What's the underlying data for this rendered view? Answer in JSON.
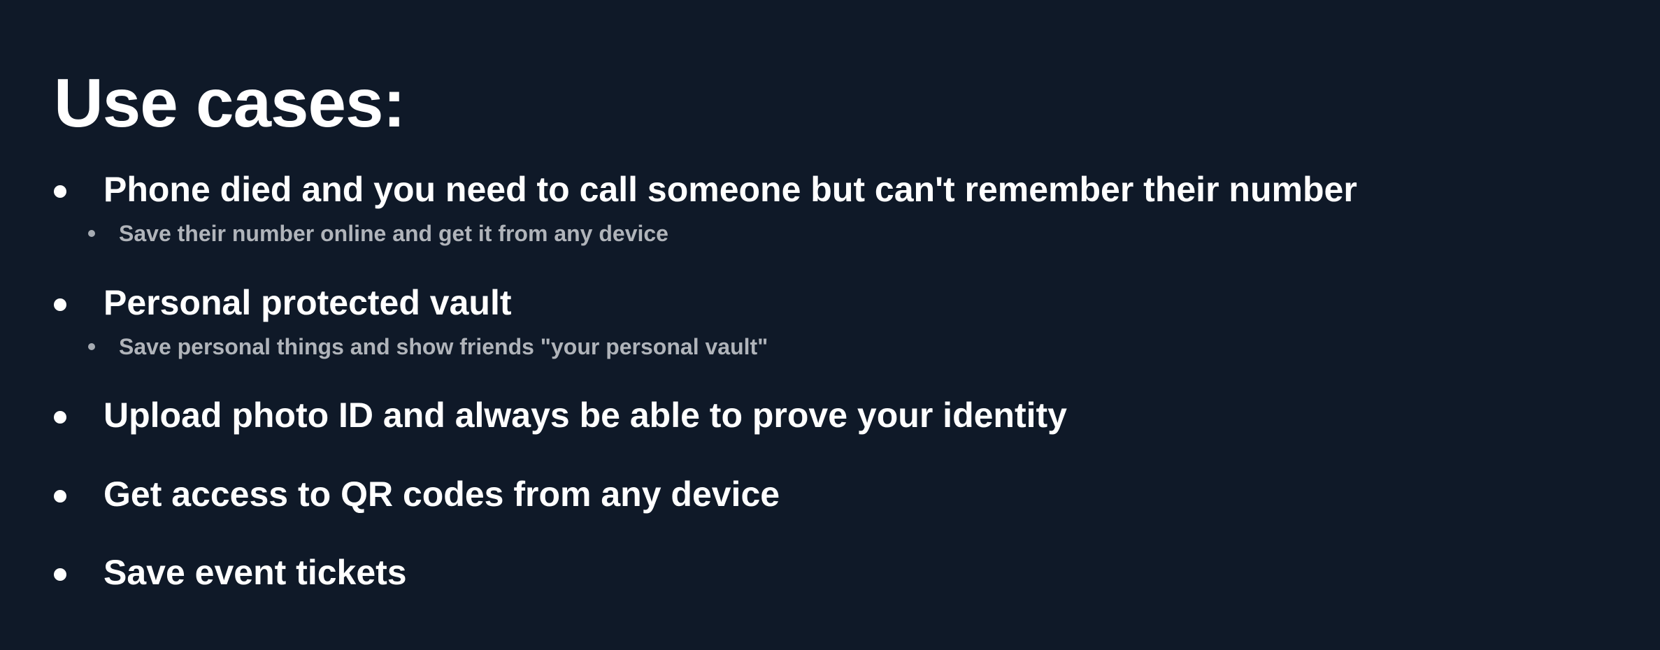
{
  "slide": {
    "title": "Use cases:",
    "items": [
      {
        "text": "Phone died and you need to call someone but can't remember their number",
        "sub": "Save their number online and get it from any device"
      },
      {
        "text": "Personal protected vault",
        "sub": "Save personal things and show friends \"your personal vault\""
      },
      {
        "text": "Upload photo ID and always be able to prove your identity"
      },
      {
        "text": "Get access to QR codes from any device"
      },
      {
        "text": "Save event tickets"
      }
    ]
  },
  "colors": {
    "background": "#0f1928",
    "primary_text": "#ffffff",
    "secondary_text": "#b0b4ba"
  }
}
